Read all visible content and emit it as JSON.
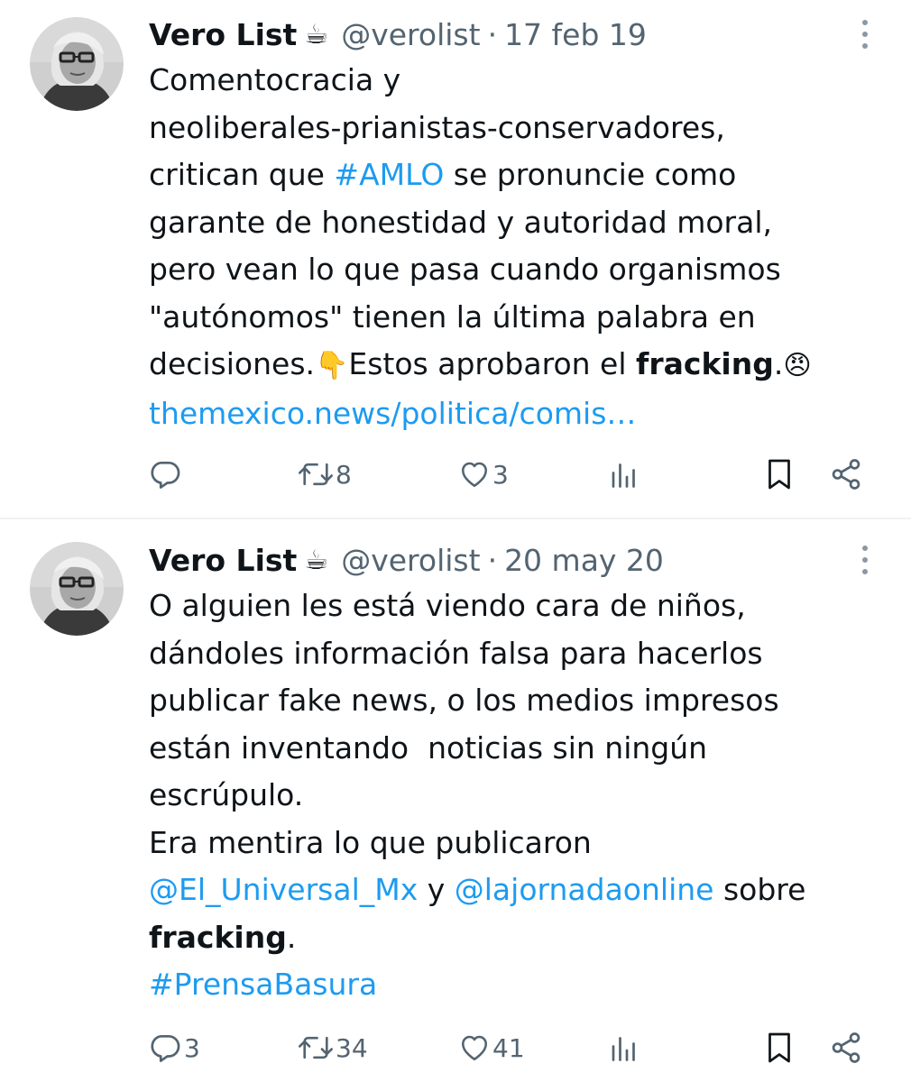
{
  "tweets": [
    {
      "author_name": "Vero List",
      "author_emoji": "☕",
      "handle": "@verolist",
      "separator": "·",
      "date": "17 feb 19",
      "text_lines": [
        [
          {
            "t": "Comentocracia y",
            "s": "plain"
          }
        ],
        [
          {
            "t": "neoliberales-prianistas-conservadores,",
            "s": "plain"
          }
        ],
        [
          {
            "t": "critican que ",
            "s": "plain"
          },
          {
            "t": "#AMLO",
            "s": "link"
          },
          {
            "t": " se pronuncie como",
            "s": "plain"
          }
        ],
        [
          {
            "t": "garante de honestidad y autoridad moral,",
            "s": "plain"
          }
        ],
        [
          {
            "t": "pero vean lo que pasa cuando organismos",
            "s": "plain"
          }
        ],
        [
          {
            "t": "\"autónomos\" tienen la última palabra en",
            "s": "plain"
          }
        ],
        [
          {
            "t": "decisiones.",
            "s": "plain"
          },
          {
            "t": "👇",
            "s": "emoji"
          },
          {
            "t": "Estos aprobaron el ",
            "s": "plain"
          },
          {
            "t": "fracking",
            "s": "bold"
          },
          {
            "t": ".",
            "s": "plain"
          },
          {
            "t": "😠",
            "s": "emoji"
          }
        ],
        [
          {
            "t": "themexico.news/politica/comis…",
            "s": "link"
          }
        ]
      ],
      "reply_count": "",
      "retweet_count": "8",
      "like_count": "3"
    },
    {
      "author_name": "Vero List",
      "author_emoji": "☕",
      "handle": "@verolist",
      "separator": "·",
      "date": "20 may 20",
      "text_lines": [
        [
          {
            "t": "O alguien les está viendo cara de niños,",
            "s": "plain"
          }
        ],
        [
          {
            "t": "dándoles información falsa para hacerlos",
            "s": "plain"
          }
        ],
        [
          {
            "t": "publicar fake news, o los medios impresos",
            "s": "plain"
          }
        ],
        [
          {
            "t": "están inventando  noticias sin ningún",
            "s": "plain"
          }
        ],
        [
          {
            "t": "escrúpulo.",
            "s": "plain"
          }
        ],
        [
          {
            "t": "Era mentira lo que publicaron",
            "s": "plain"
          }
        ],
        [
          {
            "t": "@El_Universal_Mx",
            "s": "link"
          },
          {
            "t": " y ",
            "s": "plain"
          },
          {
            "t": "@lajornadaonline",
            "s": "link"
          },
          {
            "t": " sobre",
            "s": "plain"
          }
        ],
        [
          {
            "t": "fracking",
            "s": "bold"
          },
          {
            "t": ".",
            "s": "plain"
          }
        ],
        [
          {
            "t": "#PrensaBasura",
            "s": "link"
          }
        ]
      ],
      "reply_count": "3",
      "retweet_count": "34",
      "like_count": "41"
    }
  ],
  "icons": {
    "reply": "reply-icon",
    "retweet": "retweet-icon",
    "like": "heart-icon",
    "views": "views-icon",
    "bookmark": "bookmark-icon",
    "share": "share-icon",
    "more": "more-icon"
  },
  "colors": {
    "link": "#1d9bf0",
    "muted": "#536471",
    "text": "#0f1419"
  }
}
